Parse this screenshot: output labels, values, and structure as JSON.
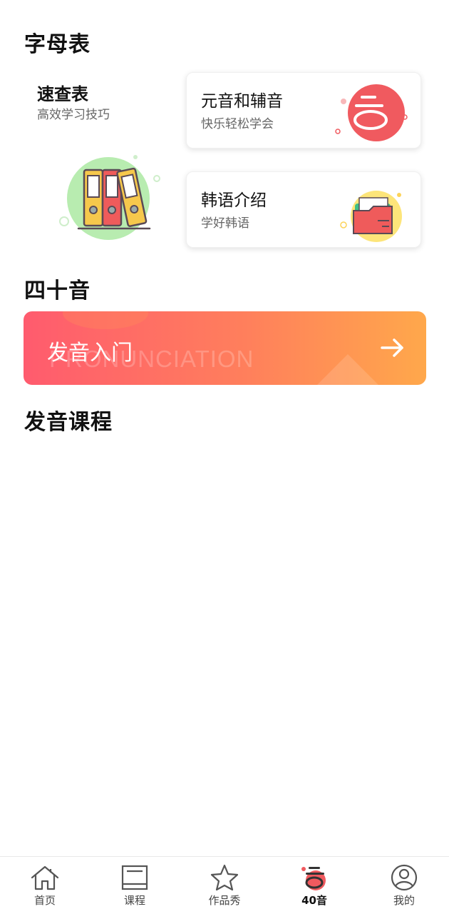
{
  "sections": {
    "alphabet_title": "字母表",
    "forty_title": "四十音",
    "course_title": "发音课程"
  },
  "quick_ref": {
    "title": "速查表",
    "subtitle": "高效学习技巧"
  },
  "cards": [
    {
      "title": "元音和辅音",
      "subtitle": "快乐轻松学会",
      "icon": "hangul-icon"
    },
    {
      "title": "韩语介绍",
      "subtitle": "学好韩语",
      "icon": "folder-icon"
    }
  ],
  "banner": {
    "title": "发音入门",
    "watermark": "PRONUNCIATION",
    "colors": {
      "start": "#ff5b6e",
      "end": "#ffa84b"
    }
  },
  "nav": {
    "items": [
      {
        "label": "首页",
        "icon": "home-icon"
      },
      {
        "label": "课程",
        "icon": "book-icon"
      },
      {
        "label": "作品秀",
        "icon": "star-icon"
      },
      {
        "label": "40音",
        "icon": "hangul-icon",
        "active": true
      },
      {
        "label": "我的",
        "icon": "profile-icon"
      }
    ]
  }
}
